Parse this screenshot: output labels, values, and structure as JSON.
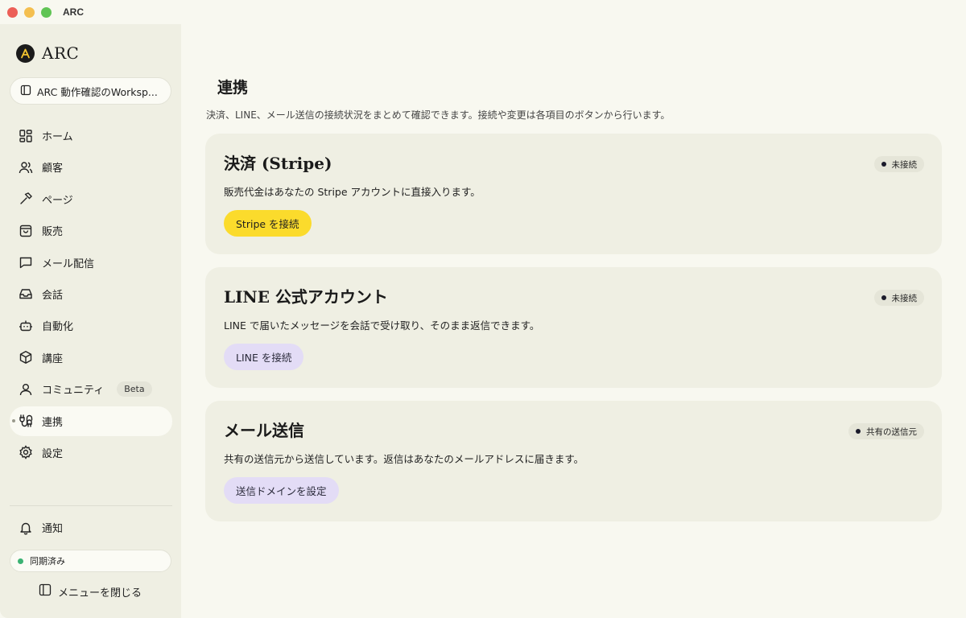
{
  "window": {
    "title": "ARC"
  },
  "brand": {
    "name": "ARC"
  },
  "workspace": {
    "label": "ARC 動作確認のWorksp..."
  },
  "nav": {
    "items": [
      {
        "label": "ホーム",
        "icon": "grid-icon"
      },
      {
        "label": "顧客",
        "icon": "users-icon"
      },
      {
        "label": "ページ",
        "icon": "hammer-icon"
      },
      {
        "label": "販売",
        "icon": "shopping-bag-icon"
      },
      {
        "label": "メール配信",
        "icon": "message-square-icon"
      },
      {
        "label": "会話",
        "icon": "inbox-icon"
      },
      {
        "label": "自動化",
        "icon": "bot-icon"
      },
      {
        "label": "講座",
        "icon": "package-icon"
      },
      {
        "label": "コミュニティ",
        "icon": "user-icon",
        "badge": "Beta"
      },
      {
        "label": "連携",
        "icon": "plug-icon",
        "active": true
      },
      {
        "label": "設定",
        "icon": "gear-icon"
      }
    ],
    "notifications": {
      "label": "通知",
      "icon": "bell-icon"
    },
    "sync_status": "同期済み",
    "close_menu": "メニューを閉じる"
  },
  "main": {
    "title": "連携",
    "description": "決済、LINE、メール送信の接続状況をまとめて確認できます。接続や変更は各項目のボタンから行います。",
    "cards": [
      {
        "title": "決済 (Stripe)",
        "status": "未接続",
        "description": "販売代金はあなたの Stripe アカウントに直接入ります。",
        "button": "Stripe を接続",
        "button_color": "#fbdb2c"
      },
      {
        "title": "LINE 公式アカウント",
        "status": "未接続",
        "description": "LINE で届いたメッセージを会話で受け取り、そのまま返信できます。",
        "button": "LINE を接続",
        "button_color": "#e3dcf6"
      },
      {
        "title": "メール送信",
        "status": "共有の送信元",
        "description": "共有の送信元から送信しています。返信はあなたのメールアドレスに届きます。",
        "button": "送信ドメインを設定",
        "button_color": "#e3dcf6"
      }
    ]
  },
  "colors": {
    "accent_yellow": "#fbdb2c",
    "sync_green": "#3bb273",
    "sidebar_bg": "#efefe3",
    "main_bg": "#f8f8f0"
  }
}
